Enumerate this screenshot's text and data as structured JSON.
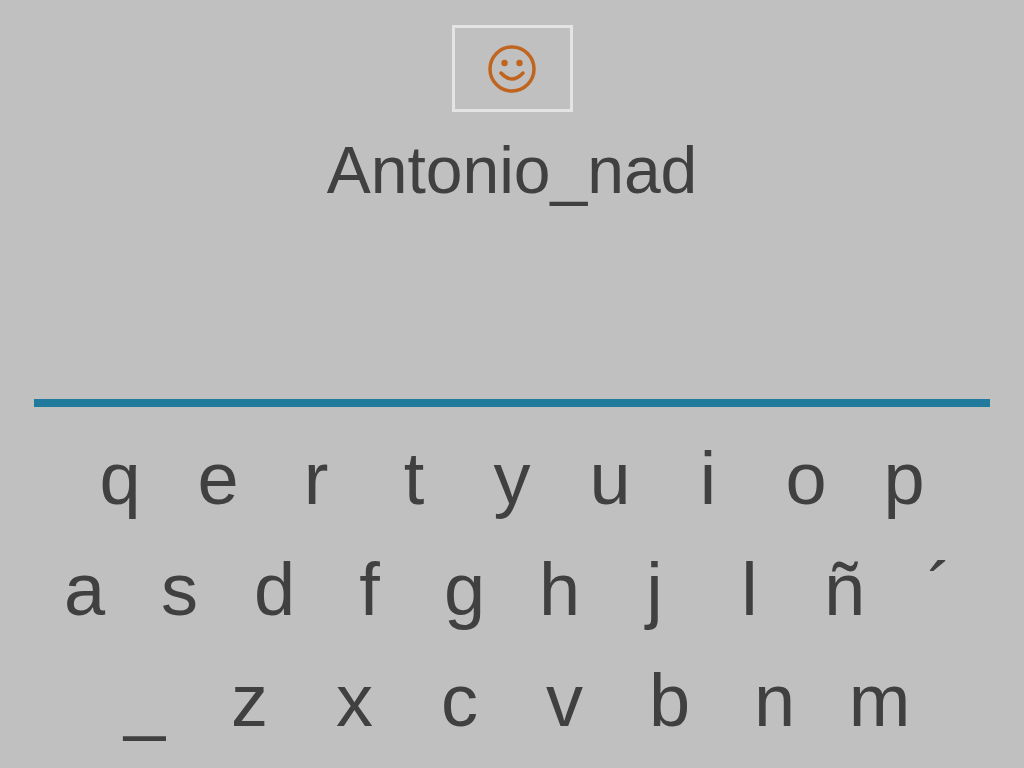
{
  "word": "Antonio_nad",
  "keyboard": {
    "rows": [
      [
        "q",
        "e",
        "r",
        "t",
        "y",
        "u",
        "i",
        "o",
        "p"
      ],
      [
        "a",
        "s",
        "d",
        "f",
        "g",
        "h",
        "j",
        "l",
        "ñ",
        "´"
      ],
      [
        "_",
        "z",
        "x",
        "c",
        "v",
        "b",
        "n",
        "m"
      ]
    ]
  }
}
